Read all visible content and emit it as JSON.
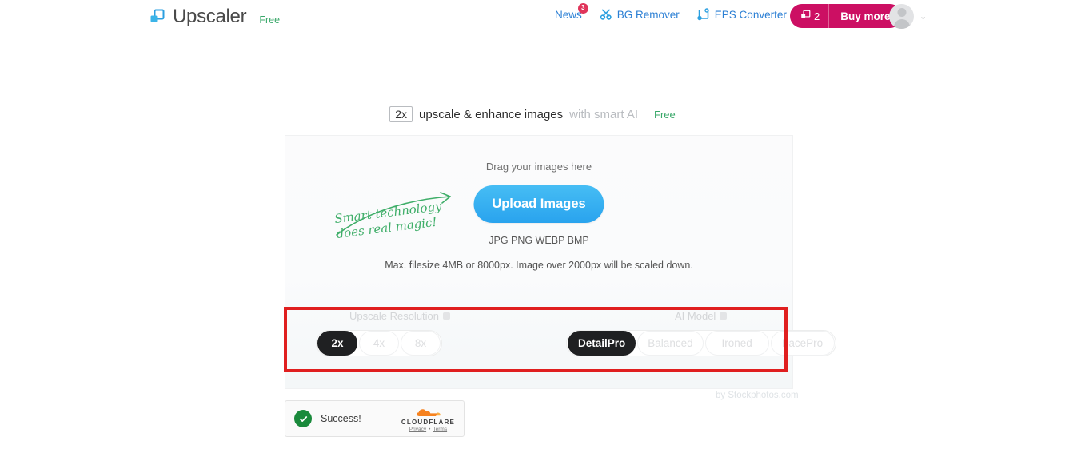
{
  "header": {
    "brand": {
      "name": "Upscaler",
      "tag": "Free",
      "icon": "overlapping-squares-logo"
    },
    "nav": [
      {
        "label": "News",
        "badge": "3",
        "icon": "news-badge"
      },
      {
        "label": "BG Remover",
        "icon": "bg-remover-icon"
      },
      {
        "label": "EPS Converter",
        "icon": "eps-converter-icon"
      }
    ],
    "credits": {
      "count": "2",
      "icon": "credits-icon",
      "buy_label": "Buy more"
    },
    "account": {
      "avatar_alt": "user-avatar",
      "chevron": "⌄"
    }
  },
  "headline": {
    "scale_badge": "2x",
    "main": "upscale & enhance images",
    "sub": "with smart AI",
    "free": "Free"
  },
  "upload": {
    "drag_text": "Drag your images here",
    "button_label": "Upload Images",
    "formats": "JPG PNG WEBP BMP",
    "maxsize": "Max. filesize 4MB or 8000px. Image over 2000px will be scaled down.",
    "scribble_line1": "Smart technology",
    "scribble_line2": "does real magic!"
  },
  "options": {
    "resolution": {
      "label": "Upscale Resolution",
      "info": "info-icon",
      "choices": [
        {
          "label": "2x",
          "selected": true
        },
        {
          "label": "4x",
          "selected": false
        },
        {
          "label": "8x",
          "selected": false
        }
      ]
    },
    "model": {
      "label": "AI Model",
      "info": "info-icon",
      "choices": [
        {
          "label": "DetailPro",
          "selected": true
        },
        {
          "label": "Balanced",
          "selected": false
        },
        {
          "label": "Ironed",
          "selected": false
        },
        {
          "label": "FacePro",
          "selected": false
        }
      ]
    }
  },
  "footer": {
    "byline": "by Stockphotos.com",
    "turnstile": {
      "status": "Success!",
      "brand": "CLOUDFLARE",
      "privacy": "Privacy",
      "separator": "•",
      "terms": "Terms"
    }
  },
  "colors": {
    "accent_blue": "#29a3ee",
    "brand_pink": "#cc0f63",
    "green": "#3aa86a",
    "highlight_red": "#e01f1f",
    "dark_pill": "#1f2022"
  }
}
